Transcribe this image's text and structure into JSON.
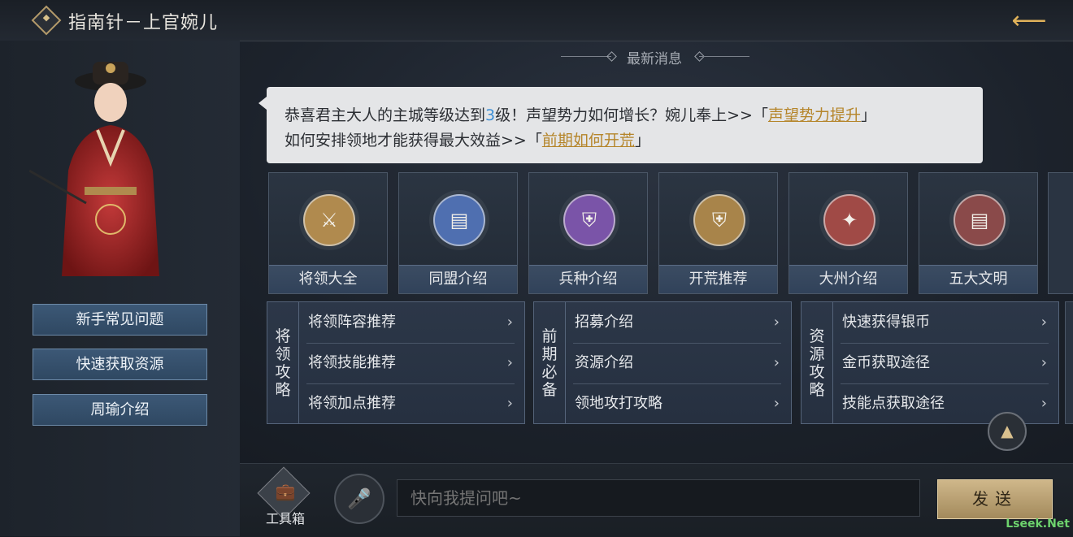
{
  "header": {
    "title": "指南针－上官婉儿",
    "back_icon": "back-arrow-icon"
  },
  "sidebar": {
    "buttons": [
      {
        "label": "新手常见问题"
      },
      {
        "label": "快速获取资源"
      },
      {
        "label": "周瑜介绍"
      }
    ]
  },
  "messages": {
    "section_title": "最新消息",
    "bubble": {
      "line1_a": "恭喜君主大人的主城等级达到",
      "line1_level": "3",
      "line1_b": "级！声望势力如何增长？婉儿奉上>>「",
      "line1_link": "声望势力提升",
      "line1_c": "」",
      "line2_a": "如何安排领地才能获得最大效益>>「",
      "line2_link": "前期如何开荒",
      "line2_c": "」"
    }
  },
  "categories": [
    {
      "label": "将领大全",
      "icon": "crossed-swords-icon",
      "color": "#b08a4e"
    },
    {
      "label": "同盟介绍",
      "icon": "book-icon",
      "color": "#4f6fb0"
    },
    {
      "label": "兵种介绍",
      "icon": "helmet-icon",
      "color": "#7a54a8"
    },
    {
      "label": "开荒推荐",
      "icon": "helmet-icon",
      "color": "#a8844a"
    },
    {
      "label": "大州介绍",
      "icon": "compass-icon",
      "color": "#a04a46"
    },
    {
      "label": "五大文明",
      "icon": "book-icon",
      "color": "#8a4a4a"
    }
  ],
  "guides": [
    {
      "title": "将领攻略",
      "items": [
        "将领阵容推荐",
        "将领技能推荐",
        "将领加点推荐"
      ]
    },
    {
      "title": "前期必备",
      "items": [
        "招募介绍",
        "资源介绍",
        "领地攻打攻略"
      ]
    },
    {
      "title": "资源攻略",
      "items": [
        "快速获得银币",
        "金币获取途径",
        "技能点获取途径"
      ]
    }
  ],
  "bottom": {
    "toolbox_label": "工具箱",
    "input_placeholder": "快向我提问吧~",
    "send_label": "发送"
  },
  "watermark": "Lseek.Net"
}
